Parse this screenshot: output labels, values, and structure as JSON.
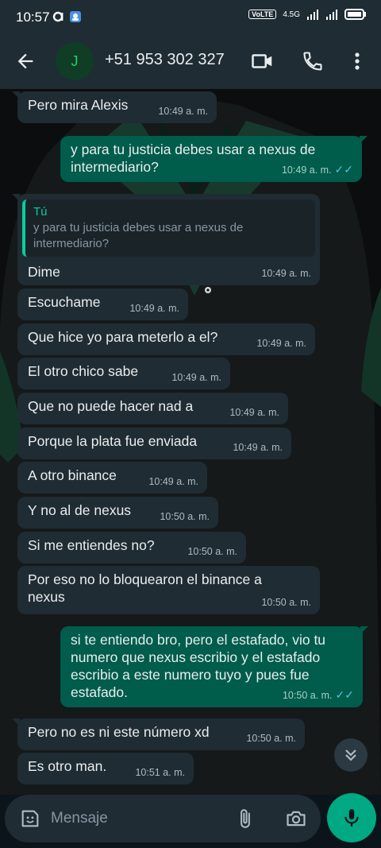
{
  "status_bar": {
    "time": "10:57",
    "network": "VoLTE",
    "signal_label": "4.5G"
  },
  "header": {
    "avatar_letter": "J",
    "contact": "+51 953 302 327"
  },
  "messages": [
    {
      "dir": "in",
      "text": "Pero mira Alexis",
      "time": "10:49 a. m."
    },
    {
      "dir": "out",
      "text": "y para tu justicia debes usar a nexus de intermediario?",
      "time": "10:49 a. m.",
      "read": true
    },
    {
      "dir": "in",
      "quote_author": "Tú",
      "quote_text": "y para tu justicia debes usar a nexus de intermediario?",
      "text": "Dime",
      "time": "10:49 a. m."
    },
    {
      "dir": "in",
      "text": "Escuchame",
      "time": "10:49 a. m."
    },
    {
      "dir": "in",
      "text": "Que hice yo para meterlo a el?",
      "time": "10:49 a. m."
    },
    {
      "dir": "in",
      "text": "El otro chico sabe",
      "time": "10:49 a. m."
    },
    {
      "dir": "in",
      "text": "Que no puede hacer nad a",
      "time": "10:49 a. m."
    },
    {
      "dir": "in",
      "text": "Porque la plata fue enviada",
      "time": "10:49 a. m."
    },
    {
      "dir": "in",
      "text": "A otro binance",
      "time": "10:49 a. m."
    },
    {
      "dir": "in",
      "text": "Y no al de nexus",
      "time": "10:50 a. m."
    },
    {
      "dir": "in",
      "text": "Si me entiendes no?",
      "time": "10:50 a. m."
    },
    {
      "dir": "in",
      "text": "Por eso no lo bloquearon el binance a nexus",
      "time": "10:50 a. m."
    },
    {
      "dir": "out",
      "text": "si te entiendo bro, pero el estafado, vio tu numero que nexus escribio y el estafado escribio a este numero tuyo y pues fue estafado.",
      "time": "10:50 a. m.",
      "read": true
    },
    {
      "dir": "in",
      "text": "Pero no es ni este número xd",
      "time": "10:50 a. m."
    },
    {
      "dir": "in",
      "text": "Es otro man.",
      "time": "10:51 a. m."
    }
  ],
  "composer": {
    "placeholder": "Mensaje"
  },
  "colors": {
    "header": "#1f2c34",
    "incoming": "#202c33",
    "outgoing": "#005c4b",
    "accent": "#00a884",
    "read_tick": "#53bdeb"
  },
  "icons": [
    "back-arrow-icon",
    "video-call-icon",
    "phone-icon",
    "more-vertical-icon",
    "scroll-down-icon",
    "emoji-sticker-icon",
    "attach-icon",
    "camera-icon",
    "mic-icon"
  ]
}
